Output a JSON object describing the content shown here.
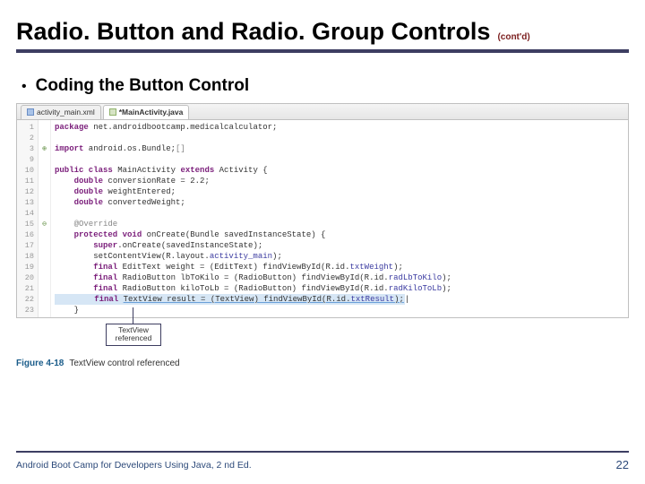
{
  "title": "Radio. Button and Radio. Group Controls",
  "contd": "(cont'd)",
  "bullet": "Coding the Button Control",
  "tabs": {
    "xml": "activity_main.xml",
    "java": "*MainActivity.java"
  },
  "gutter": [
    "1",
    "2",
    "3",
    "9",
    "10",
    "11",
    "12",
    "13",
    "14",
    "15",
    "16",
    "17",
    "18",
    "19",
    "20",
    "21",
    "22",
    "23"
  ],
  "markers": [
    "",
    "",
    "⊕",
    "",
    "",
    "",
    "",
    "",
    "",
    "⊖",
    "",
    "",
    "",
    "",
    "",
    "",
    "",
    "",
    ""
  ],
  "code": {
    "l1a": "package",
    "l1b": " net.androidbootcamp.medicalcalculator;",
    "l3a": "import",
    "l3b": " android.os.Bundle;",
    "l3c": "[]",
    "l10a": "public class ",
    "l10b": "MainActivity ",
    "l10c": "extends ",
    "l10d": "Activity {",
    "l11a": "    double ",
    "l11b": "conversionRate = 2.2;",
    "l12a": "    double ",
    "l12b": "weightEntered;",
    "l13a": "    double ",
    "l13b": "convertedWeight;",
    "l15a": "    @Override",
    "l16a": "    protected void ",
    "l16b": "onCreate(Bundle savedInstanceState) {",
    "l17a": "        super",
    "l17b": ".onCreate(savedInstanceState);",
    "l18a": "        setContentView(R.layout.",
    "l18b": "activity_main",
    "l18c": ");",
    "l19a": "        final ",
    "l19b": "EditText weight = (EditText) findViewById(R.id.",
    "l19c": "txtWeight",
    "l19d": ");",
    "l20a": "        final ",
    "l20b": "RadioButton lbToKilo = (RadioButton) findViewById(R.id.",
    "l20c": "radLbToKilo",
    "l20d": ");",
    "l21a": "        final ",
    "l21b": "RadioButton kiloToLb = (RadioButton) findViewById(R.id.",
    "l21c": "radKiloToLb",
    "l21d": ");",
    "l22a": "        final ",
    "l22b": "TextView result = (TextView) findViewById(R.id.",
    "l22c": "txtResult",
    "l22d": ");",
    "l22cursor": "|",
    "l23a": "    }"
  },
  "callout": "TextView referenced",
  "figure": {
    "num": "Figure 4-18",
    "caption": "TextView control referenced"
  },
  "footer": "Android Boot Camp for Developers Using Java, 2 nd Ed.",
  "page": "22"
}
